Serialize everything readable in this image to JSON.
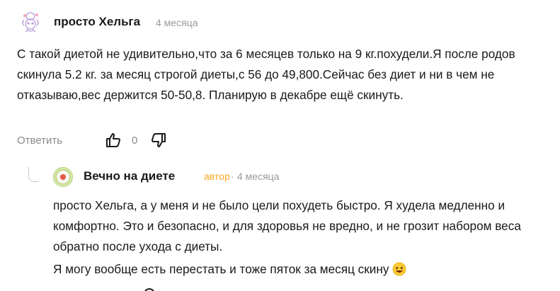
{
  "comment": {
    "author": "просто Хельга",
    "time": "4 месяца",
    "text": "С такой диетой не удивительно,что за 6 месяцев только на 9 кг.похудели.Я после родов скинула 5.2 кг. за месяц строгой диеты,с 56 до 49,800.Сейчас без диет и ни в чем не отказываю,вес держится 50-50,8. Планирую в декабре ещё скинуть.",
    "reply_label": "Ответить",
    "score": "0",
    "avatar_icon": "flower-doodle-avatar",
    "like_icon": "thumbs-up-icon",
    "dislike_icon": "thumbs-down-icon"
  },
  "reply": {
    "author": "Вечно на диете",
    "role": "автор",
    "separator": "·",
    "time": "4 месяца",
    "paragraph1": "просто Хельга, а у меня и не было цели похудеть быстро. Я худела медленно и комфортно. Это и безопасно, и для здоровья не вредно, и не грозит набором веса обратно после ухода с диеты.",
    "paragraph2": "Я могу вообще есть перестать и тоже пяток за месяц скину",
    "avatar_icon": "diet-logo-avatar",
    "emoji_icon": "laughing-emoji"
  },
  "colors": {
    "text": "#1a1a1a",
    "muted": "#8a8a8a",
    "author_badge": "#f5a623"
  }
}
